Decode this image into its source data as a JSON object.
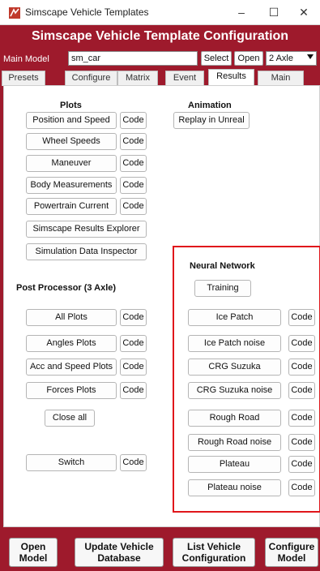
{
  "window": {
    "title": "Simscape Vehicle Templates",
    "controls": [
      "–",
      "☐",
      "✕"
    ]
  },
  "header": {
    "title": "Simscape Vehicle Template Configuration"
  },
  "model_bar": {
    "label": "Main Model",
    "model_value": "sm_car",
    "select_label": "Select",
    "open_label": "Open",
    "axle_value": "2 Axle"
  },
  "tabs": [
    {
      "label": "Presets"
    },
    {
      "label": "Configure"
    },
    {
      "label": "Matrix"
    },
    {
      "label": "Event"
    },
    {
      "label": "Results",
      "active": true
    },
    {
      "label": "Main"
    }
  ],
  "plots": {
    "heading": "Plots",
    "code_label": "Code",
    "items": [
      "Position and Speed",
      "Wheel Speeds",
      "Maneuver",
      "Body Measurements",
      "Powertrain Current"
    ],
    "explorer_label": "Simscape Results Explorer",
    "inspector_label": "Simulation Data Inspector"
  },
  "animation": {
    "heading": "Animation",
    "replay_label": "Replay in Unreal"
  },
  "post_processor": {
    "heading": "Post Processor (3 Axle)",
    "items": [
      "All Plots",
      "Angles Plots",
      "Acc and Speed Plots",
      "Forces Plots"
    ],
    "close_all_label": "Close all",
    "switch_label": "Switch"
  },
  "neural_network": {
    "heading": "Neural Network",
    "training_label": "Training",
    "items": [
      "Ice Patch",
      "Ice Patch noise",
      "CRG Suzuka",
      "CRG Suzuka noise",
      "Rough Road",
      "Rough Road noise",
      "Plateau",
      "Plateau noise"
    ]
  },
  "bottom_buttons": [
    "Open\nModel",
    "Update Vehicle\nDatabase",
    "List Vehicle\nConfiguration",
    "Configure\nModel"
  ],
  "colors": {
    "panel_red": "#9e1a2c",
    "highlight_box": "#e0161b"
  }
}
